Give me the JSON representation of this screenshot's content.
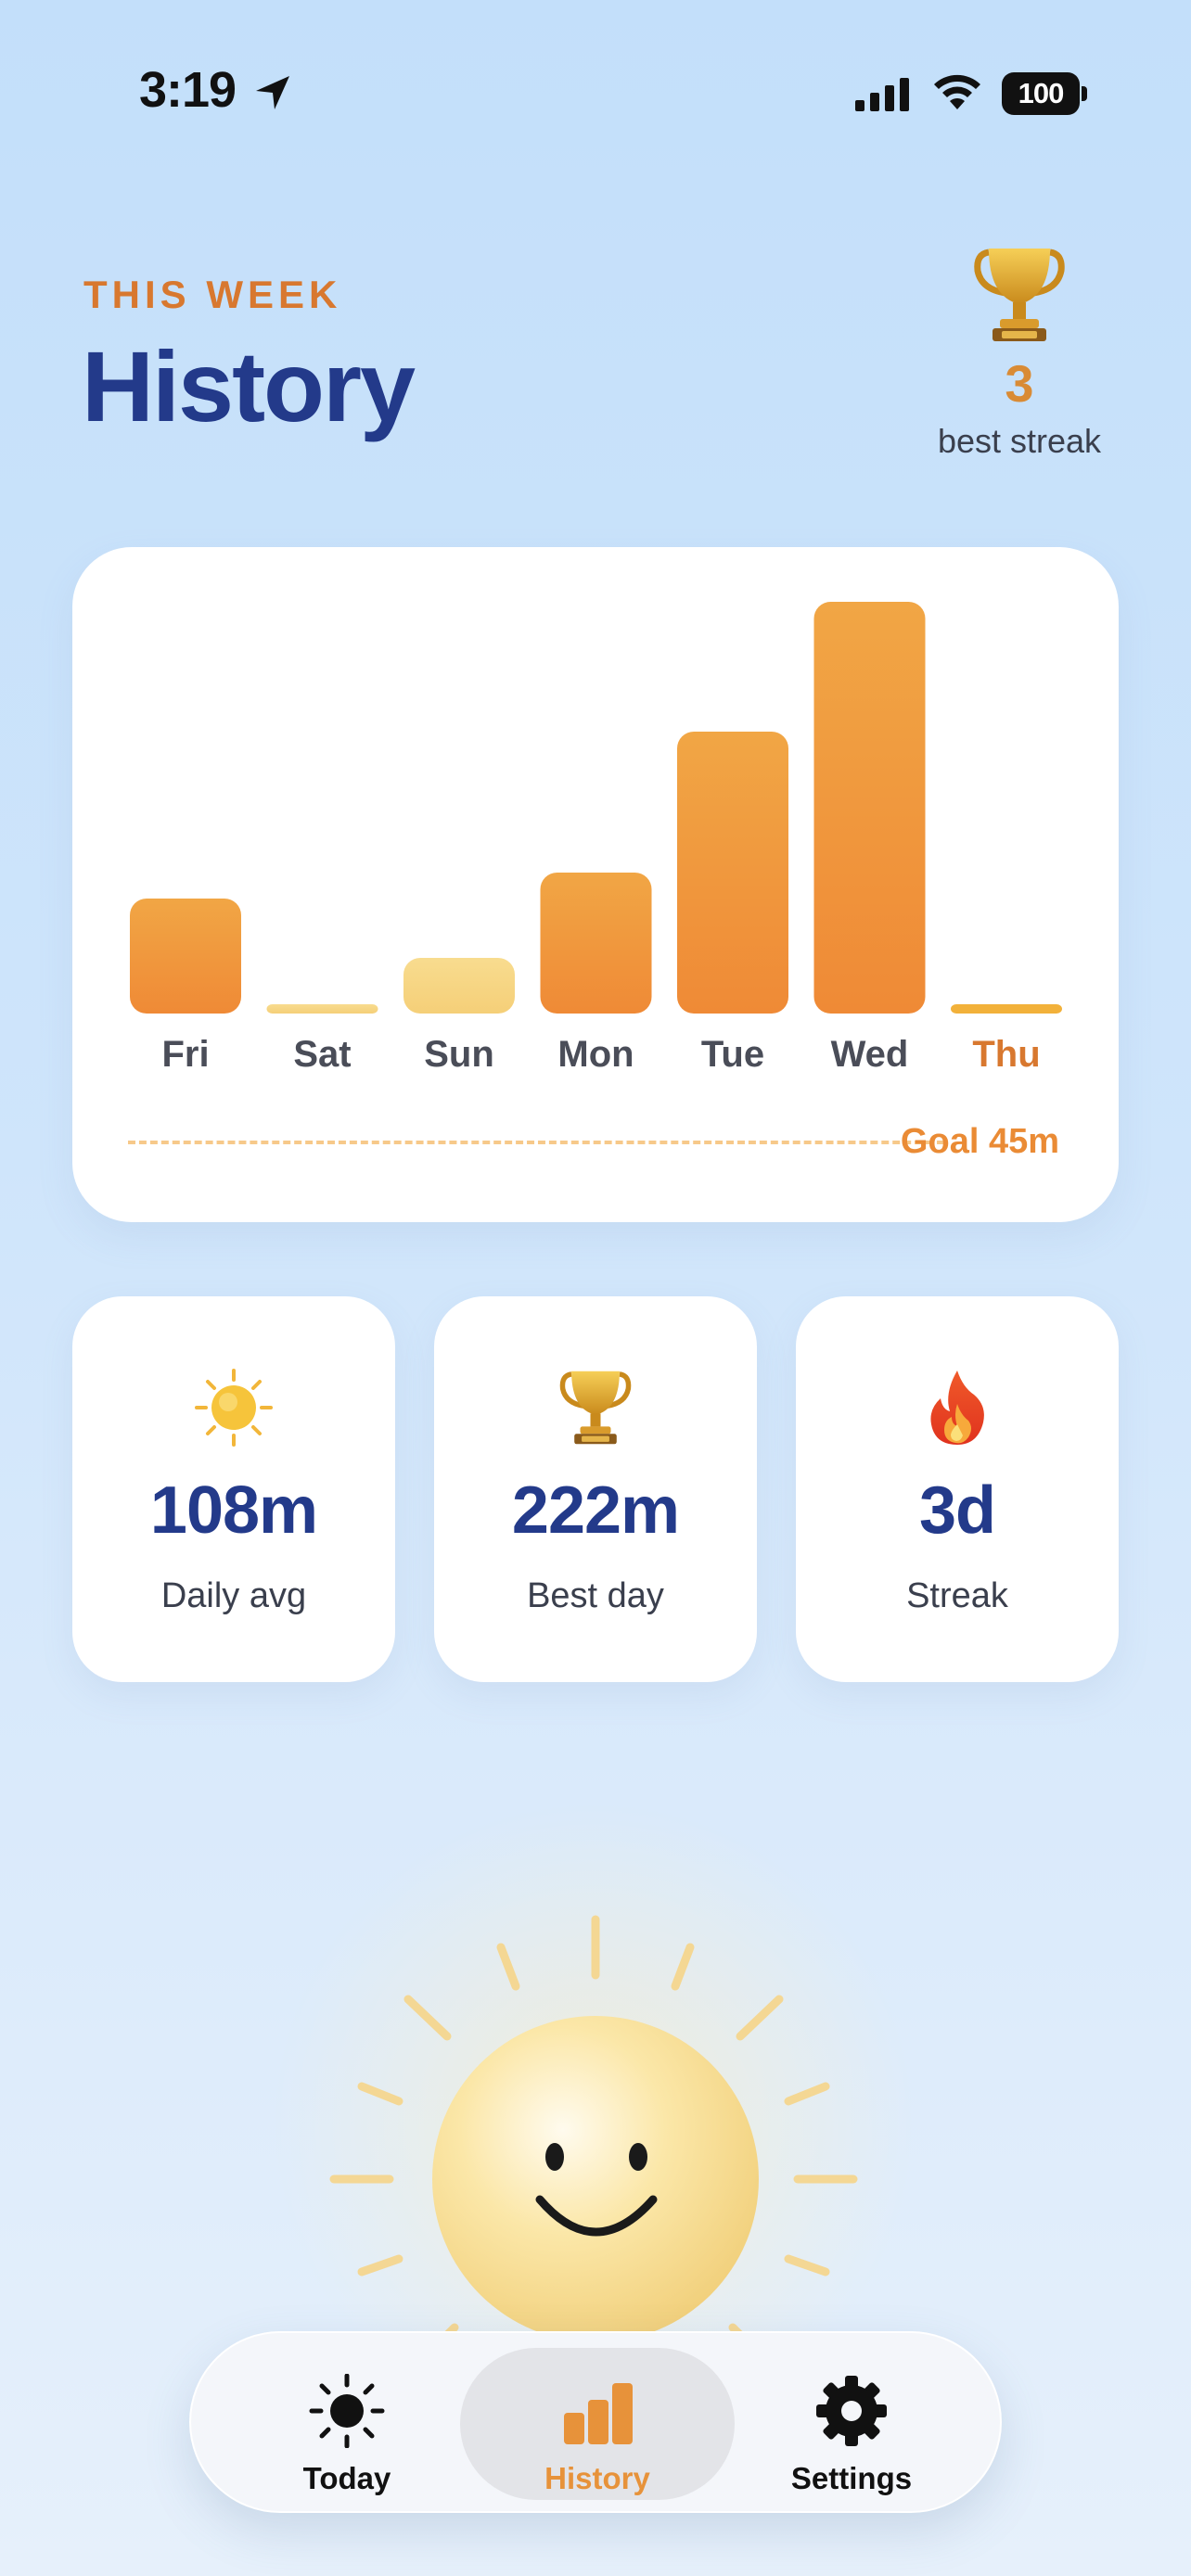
{
  "status_bar": {
    "time": "3:19",
    "battery": "100"
  },
  "header": {
    "eyebrow": "THIS WEEK",
    "title": "History",
    "best_streak_value": "3",
    "best_streak_label": "best streak",
    "best_streak_icon": "trophy-icon"
  },
  "chart_data": {
    "type": "bar",
    "categories": [
      "Fri",
      "Sat",
      "Sun",
      "Mon",
      "Tue",
      "Wed",
      "Thu"
    ],
    "values": [
      62,
      2,
      30,
      76,
      152,
      222,
      2
    ],
    "highlight_category": "Thu",
    "goal": 45,
    "goal_label": "Goal 45m",
    "colors": {
      "bar": "#f0913b",
      "bar_light": "#f7d583",
      "today_label": "#d8782f"
    }
  },
  "stats": [
    {
      "icon": "sun-icon",
      "value": "108m",
      "label": "Daily avg"
    },
    {
      "icon": "trophy-icon",
      "value": "222m",
      "label": "Best day"
    },
    {
      "icon": "fire-icon",
      "value": "3d",
      "label": "Streak"
    }
  ],
  "tabs": [
    {
      "label": "Today",
      "icon": "sun-icon",
      "active": false
    },
    {
      "label": "History",
      "icon": "bar-chart-icon",
      "active": true
    },
    {
      "label": "Settings",
      "icon": "gear-icon",
      "active": false
    }
  ],
  "colors": {
    "accent": "#e7923a",
    "title": "#233a8a"
  }
}
